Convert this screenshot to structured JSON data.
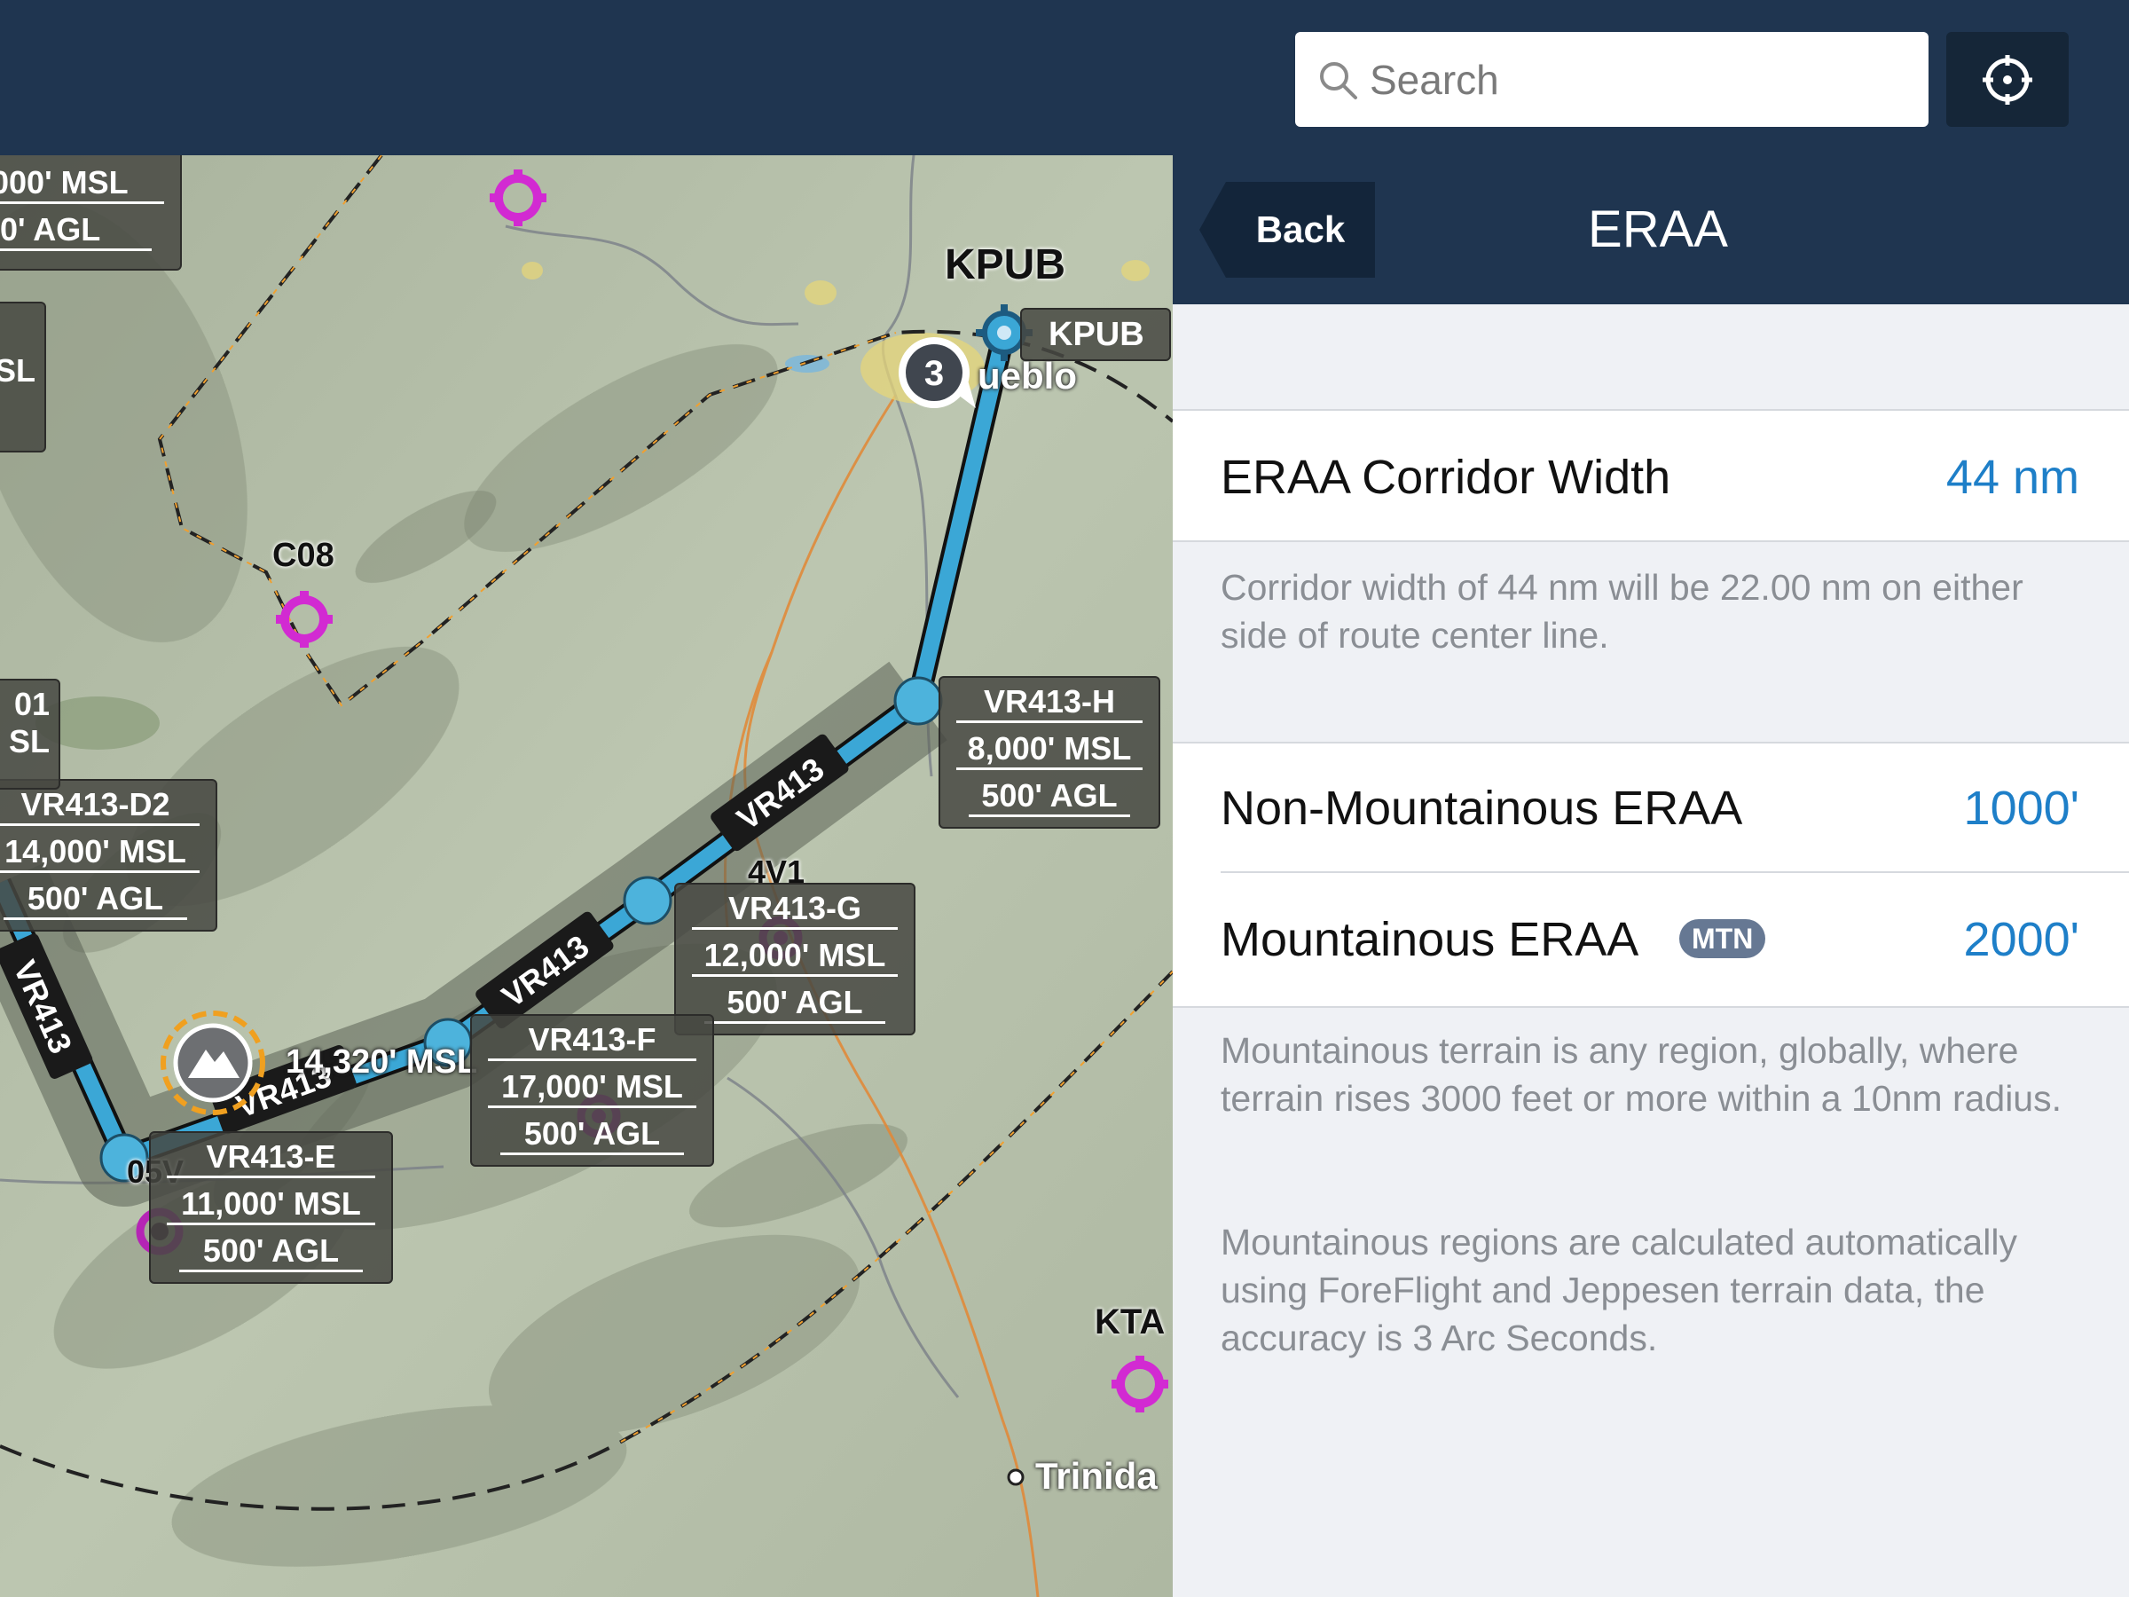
{
  "header": {
    "search": {
      "placeholder": "Search",
      "value": ""
    },
    "locate_icon": "crosshair-icon"
  },
  "map": {
    "airport_label": "KPUB",
    "airport_tag": "KPUB",
    "city_label": "ueblo",
    "cluster_count": "3",
    "c08_label": "C08",
    "v4v1_label": "4V1",
    "v05v_label": "05V",
    "kta_label": "KTA",
    "trinidad_label": "Trinida",
    "route_labels": [
      "VR413",
      "VR413",
      "VR413",
      "VR413"
    ],
    "peak_label": "14,320' MSL",
    "waypoints": [
      {
        "name": "VR413-H",
        "msl": "8,000' MSL",
        "agl": "500' AGL"
      },
      {
        "name": "VR413-G",
        "msl": "12,000' MSL",
        "agl": "500' AGL"
      },
      {
        "name": "VR413-F",
        "msl": "17,000' MSL",
        "agl": "500' AGL"
      },
      {
        "name": "VR413-E",
        "msl": "11,000' MSL",
        "agl": "500' AGL"
      },
      {
        "name": "VR413-D2",
        "msl": "14,000' MSL",
        "agl": "500' AGL"
      }
    ],
    "partial_tag_top": {
      "msl": ",000' MSL",
      "agl": "00' AGL"
    },
    "partial_tag_left": {
      "l1": "SL"
    },
    "partial_tag_left2": {
      "l1": "01",
      "l2": "SL",
      "l3": "L"
    }
  },
  "panel": {
    "back_label": "Back",
    "title": "ERAA",
    "corridor": {
      "label": "ERAA Corridor Width",
      "value": "44 nm"
    },
    "corridor_note": "Corridor width of 44 nm will be 22.00 nm on either side of route center line.",
    "non_mountainous": {
      "label": "Non-Mountainous ERAA",
      "value": "1000'"
    },
    "mountainous": {
      "label": "Mountainous ERAA",
      "badge": "MTN",
      "value": "2000'"
    },
    "mountain_note_1": "Mountainous terrain is any region, globally, where terrain rises 3000 feet or more within a 10nm radius.",
    "mountain_note_2": "Mountainous regions are calculated automatically using ForeFlight and Jeppesen terrain data, the accuracy is 3 Arc Seconds."
  },
  "colors": {
    "nav_bg": "#1f3550",
    "accent_value": "#1e7fc8",
    "route": "#3ba7d6",
    "airport_magenta": "#d22ad2",
    "badge": "#667893"
  }
}
